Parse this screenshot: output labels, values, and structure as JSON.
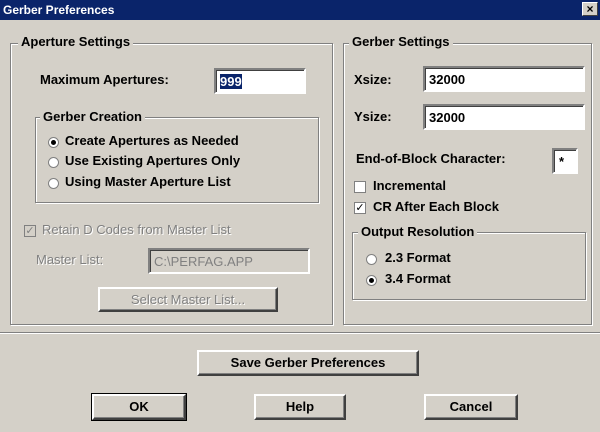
{
  "window": {
    "title": "Gerber Preferences",
    "close_glyph": "×"
  },
  "aperture": {
    "label": "Aperture Settings",
    "max_label": "Maximum Apertures:",
    "max_value": "999",
    "creation": {
      "label": "Gerber Creation",
      "options": [
        {
          "label": "Create Apertures as Needed",
          "selected": true
        },
        {
          "label": "Use Existing Apertures Only",
          "selected": false
        },
        {
          "label": "Using Master Aperture List",
          "selected": false
        }
      ]
    },
    "retain_label": "Retain D Codes from Master List",
    "retain_checked": true,
    "retain_mark": "✓",
    "master_label": "Master List:",
    "master_value": "C:\\PERFAG.APP",
    "select_button": "Select Master List..."
  },
  "gerber": {
    "label": "Gerber Settings",
    "xsize_label": "Xsize:",
    "xsize_value": "32000",
    "ysize_label": "Ysize:",
    "ysize_value": "32000",
    "eob_label": "End-of-Block Character:",
    "eob_value": "*",
    "incremental_label": "Incremental",
    "incremental_checked": false,
    "cr_label": "CR After Each Block",
    "cr_checked": true,
    "cr_mark": "✓",
    "resolution": {
      "label": "Output Resolution",
      "options": [
        {
          "label": "2.3 Format",
          "selected": false
        },
        {
          "label": "3.4 Format",
          "selected": true
        }
      ]
    }
  },
  "buttons": {
    "save": "Save Gerber Preferences",
    "ok": "OK",
    "help": "Help",
    "cancel": "Cancel"
  }
}
